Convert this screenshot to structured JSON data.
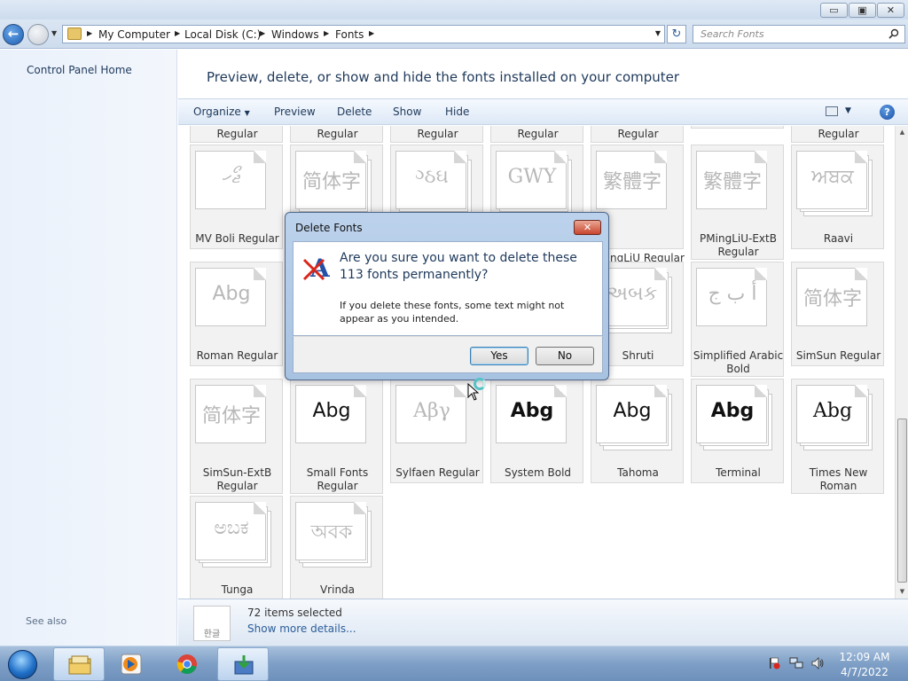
{
  "window": {
    "minimize_label": "▭",
    "maximize_label": "▣",
    "close_label": "✕"
  },
  "address": {
    "breadcrumbs": [
      "My Computer",
      "Local Disk (C:)",
      "Windows",
      "Fonts"
    ],
    "search_placeholder": "Search Fonts"
  },
  "sidebar": {
    "control_panel_home": "Control Panel Home",
    "see_also": "See also"
  },
  "main": {
    "title": "Preview, delete, or show and hide the fonts installed on your computer"
  },
  "toolbar": {
    "organize": "Organize",
    "preview": "Preview",
    "delete": "Delete",
    "show": "Show",
    "hide": "Hide"
  },
  "fonts": {
    "partial_row": [
      "Regular",
      "Regular",
      "Regular",
      "Regular",
      "Regular",
      "",
      "Regular"
    ],
    "row1": [
      {
        "name": "MV Boli Regular",
        "sample": "ޖޯހ"
      },
      {
        "name": "",
        "sample": "简体字"
      },
      {
        "name": "",
        "sample": "ગ્ઠઘ"
      },
      {
        "name": "",
        "sample": "GWY"
      },
      {
        "name": "PMingLiU Regular",
        "sample": "繁體字"
      },
      {
        "name": "PMingLiU-ExtB Regular",
        "sample": "繁體字"
      },
      {
        "name": "Raavi",
        "sample": "ਅਬਕ"
      }
    ],
    "row2": [
      {
        "name": "Roman Regular",
        "sample": "Abg"
      },
      {
        "name": "Shruti",
        "sample": "અબક"
      },
      {
        "name": "Simplified Arabic Bold",
        "sample": "أ ب ج"
      },
      {
        "name": "SimSun Regular",
        "sample": "简体字"
      }
    ],
    "row3": [
      {
        "name": "SimSun-ExtB Regular",
        "sample": "简体字"
      },
      {
        "name": "Small Fonts Regular",
        "sample": "Abg"
      },
      {
        "name": "Sylfaen Regular",
        "sample": "Αβγ"
      },
      {
        "name": "System Bold",
        "sample": "Abg"
      },
      {
        "name": "Tahoma",
        "sample": "Abg"
      },
      {
        "name": "Terminal",
        "sample": "Abg"
      },
      {
        "name": "Times New Roman",
        "sample": "Abg"
      }
    ],
    "row4": [
      {
        "name": "Tunga",
        "sample": "ಅಬಕ"
      },
      {
        "name": "Vrinda",
        "sample": "অবক"
      }
    ]
  },
  "details": {
    "icon_glyph": "한글",
    "selected": "72 items selected",
    "more": "Show more details..."
  },
  "dialog": {
    "title": "Delete Fonts",
    "close_label": "✕",
    "main_text": "Are you sure you want to delete these 113 fonts permanently?",
    "sub_text": "If you delete these fonts, some text might not appear as you intended.",
    "yes": "Yes",
    "no": "No"
  },
  "taskbar": {
    "time": "12:09 AM",
    "date": "4/7/2022"
  },
  "colors": {
    "accent": "#1e395b",
    "link": "#2b5d9a"
  }
}
